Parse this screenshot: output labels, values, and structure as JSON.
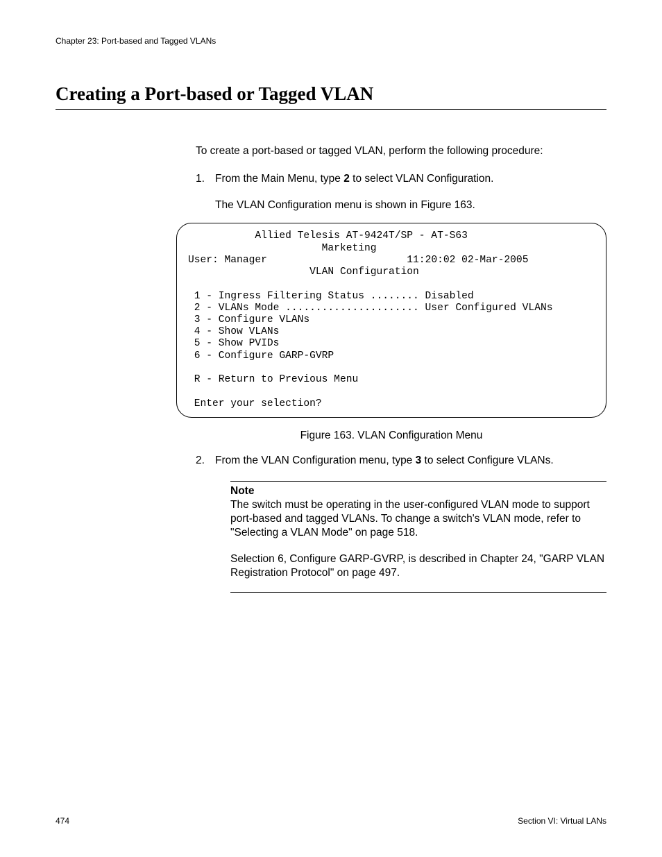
{
  "header": {
    "chapter": "Chapter 23: Port-based and Tagged VLANs"
  },
  "heading": "Creating a Port-based or Tagged VLAN",
  "intro": "To create a port-based or tagged VLAN, perform the following procedure:",
  "step1": {
    "num": "1.",
    "before_bold": "From the Main Menu, type ",
    "bold": "2",
    "after_bold": " to select VLAN Configuration.",
    "sub": "The VLAN Configuration menu is shown in Figure 163."
  },
  "terminal": {
    "line1": "           Allied Telesis AT-9424T/SP - AT-S63",
    "line2": "                      Marketing",
    "line3a": "User: Manager",
    "line3b": "11:20:02 02-Mar-2005",
    "line4": "                    VLAN Configuration",
    "opt1": " 1 - Ingress Filtering Status ........ Disabled",
    "opt2": " 2 - VLANs Mode ...................... User Configured VLANs",
    "opt3": " 3 - Configure VLANs",
    "opt4": " 4 - Show VLANs",
    "opt5": " 5 - Show PVIDs",
    "opt6": " 6 - Configure GARP-GVRP",
    "optR": " R - Return to Previous Menu",
    "prompt": " Enter your selection?"
  },
  "figure_caption": "Figure 163. VLAN Configuration Menu",
  "step2": {
    "num": "2.",
    "before_bold": "From the VLAN Configuration menu, type ",
    "bold": "3",
    "after_bold": " to select Configure VLANs."
  },
  "note": {
    "label": "Note",
    "p1": "The switch must be operating in the user-configured VLAN mode to support port-based and tagged VLANs. To change a switch's VLAN mode, refer to \"Selecting a VLAN Mode\" on page 518.",
    "p2": "Selection 6, Configure GARP-GVRP, is described in Chapter 24, \"GARP VLAN Registration Protocol\" on page 497."
  },
  "footer": {
    "page": "474",
    "section": "Section VI: Virtual LANs"
  }
}
